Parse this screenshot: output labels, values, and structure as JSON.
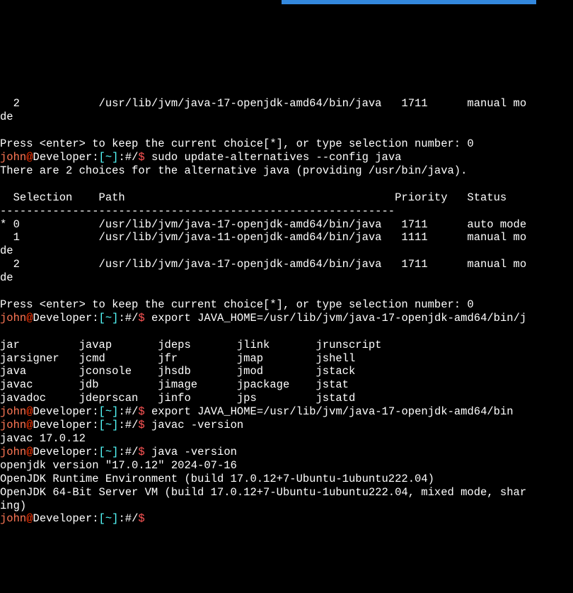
{
  "prompt": {
    "user": "john",
    "at": "@",
    "host": "Developer:",
    "lbracket": "[",
    "tilde": "~",
    "rbracket": "]",
    "path": ":#/",
    "dollar": "$"
  },
  "lines": {
    "l1": "  2            /usr/lib/jvm/java-17-openjdk-amd64/bin/java   1711      manual mo",
    "l2": "de",
    "l3": "",
    "l4": "Press <enter> to keep the current choice[*], or type selection number: 0",
    "cmd1": " sudo update-alternatives --config java",
    "l5": "There are 2 choices for the alternative java (providing /usr/bin/java).",
    "l6": "",
    "l7": "  Selection    Path                                         Priority   Status",
    "l8": "------------------------------------------------------------",
    "l9": "* 0            /usr/lib/jvm/java-17-openjdk-amd64/bin/java   1711      auto mode",
    "l10": "  1            /usr/lib/jvm/java-11-openjdk-amd64/bin/java   1111      manual mo",
    "l11": "de",
    "l12": "  2            /usr/lib/jvm/java-17-openjdk-amd64/bin/java   1711      manual mo",
    "l13": "de",
    "l14": "",
    "l15": "Press <enter> to keep the current choice[*], or type selection number: 0",
    "cmd2": " export JAVA_HOME=/usr/lib/jvm/java-17-openjdk-amd64/bin/j",
    "l16": "",
    "l17": "jar         javap       jdeps       jlink       jrunscript",
    "l18": "jarsigner   jcmd        jfr         jmap        jshell",
    "l19": "java        jconsole    jhsdb       jmod        jstack",
    "l20": "javac       jdb         jimage      jpackage    jstat",
    "l21": "javadoc     jdeprscan   jinfo       jps         jstatd",
    "cmd3": " export JAVA_HOME=/usr/lib/jvm/java-17-openjdk-amd64/bin",
    "cmd4": " javac -version",
    "l22": "javac 17.0.12",
    "cmd5": " java -version",
    "l23": "openjdk version \"17.0.12\" 2024-07-16",
    "l24": "OpenJDK Runtime Environment (build 17.0.12+7-Ubuntu-1ubuntu222.04)",
    "l25": "OpenJDK 64-Bit Server VM (build 17.0.12+7-Ubuntu-1ubuntu222.04, mixed mode, shar",
    "l26": "ing)",
    "cmd6": " "
  }
}
